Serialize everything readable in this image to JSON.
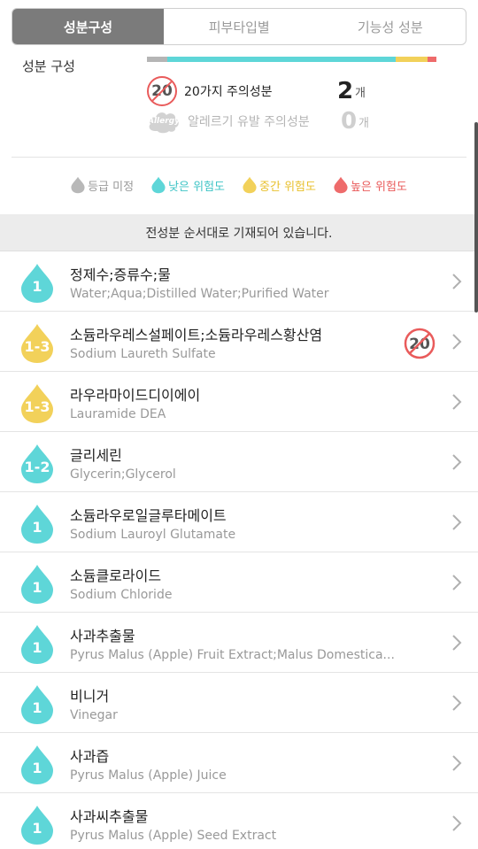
{
  "tabs": [
    {
      "label": "성분구성",
      "active": true
    },
    {
      "label": "피부타입별",
      "active": false
    },
    {
      "label": "기능성 성분",
      "active": false
    }
  ],
  "summary": {
    "label": "성분 구성",
    "bar": [
      {
        "color": "#b5b5b5",
        "fraction": 0.07
      },
      {
        "color": "#5ed6d8",
        "fraction": 0.79
      },
      {
        "color": "#f2d15a",
        "fraction": 0.11
      },
      {
        "color": "#ee6b6b",
        "fraction": 0.03
      }
    ],
    "caution20": {
      "badge": "20",
      "label": "20가지 주의성분",
      "count": "2",
      "unit": "개"
    },
    "allergy": {
      "badge": "Allergy",
      "label": "알레르기 유발 주의성분",
      "count": "0",
      "unit": "개"
    }
  },
  "legend": [
    {
      "label": "등급 미정",
      "color": "#b8b8b8",
      "text_color": "#9a9a9a"
    },
    {
      "label": "낮은 위험도",
      "color": "#5ed6d8",
      "text_color": "#3fc4c6"
    },
    {
      "label": "중간 위험도",
      "color": "#f2d15a",
      "text_color": "#e8c02e"
    },
    {
      "label": "높은 위험도",
      "color": "#ee6b6b",
      "text_color": "#e95b5b"
    }
  ],
  "notice": "전성분 순서대로 기재되어 있습니다.",
  "ingredients": [
    {
      "grade": "1",
      "level": "low",
      "kor": "정제수;증류수;물",
      "eng": "Water;Aqua;Distilled Water;Purified Water",
      "caution20": false
    },
    {
      "grade": "1-3",
      "level": "mid",
      "kor": "소듐라우레스설페이트;소듐라우레스황산염",
      "eng": "Sodium Laureth Sulfate",
      "caution20": true
    },
    {
      "grade": "1-3",
      "level": "mid",
      "kor": "라우라마이드디이에이",
      "eng": "Lauramide DEA",
      "caution20": false
    },
    {
      "grade": "1-2",
      "level": "low",
      "kor": "글리세린",
      "eng": "Glycerin;Glycerol",
      "caution20": false
    },
    {
      "grade": "1",
      "level": "low",
      "kor": "소듐라우로일글루타메이트",
      "eng": "Sodium Lauroyl Glutamate",
      "caution20": false
    },
    {
      "grade": "1",
      "level": "low",
      "kor": "소듐클로라이드",
      "eng": "Sodium Chloride",
      "caution20": false
    },
    {
      "grade": "1",
      "level": "low",
      "kor": "사과추출물",
      "eng": "Pyrus Malus (Apple) Fruit Extract;Malus Domestica...",
      "caution20": false
    },
    {
      "grade": "1",
      "level": "low",
      "kor": "비니거",
      "eng": "Vinegar",
      "caution20": false
    },
    {
      "grade": "1",
      "level": "low",
      "kor": "사과즙",
      "eng": "Pyrus Malus (Apple) Juice",
      "caution20": false
    },
    {
      "grade": "1",
      "level": "low",
      "kor": "사과씨추출물",
      "eng": "Pyrus Malus (Apple) Seed Extract",
      "caution20": false
    }
  ],
  "colors": {
    "low": "#5ed6d8",
    "mid": "#f2d15a",
    "high": "#ee6b6b",
    "unknown": "#b8b8b8"
  }
}
